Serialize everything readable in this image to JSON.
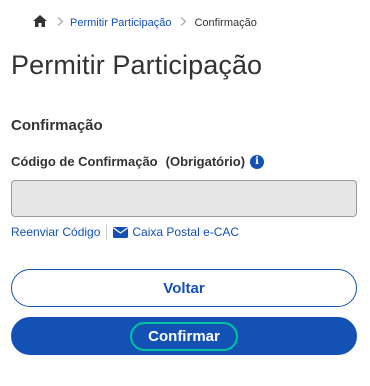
{
  "breadcrumb": {
    "home_icon": "home-icon",
    "items": [
      "Permitir Participação",
      "Confirmação"
    ]
  },
  "page": {
    "title": "Permitir Participação",
    "section": "Confirmação"
  },
  "form": {
    "label": "Código de Confirmação",
    "required": "(Obrigatório)",
    "info_icon": "info-icon",
    "code_value": "",
    "links": {
      "resend": "Reenviar Código",
      "mailbox": "Caixa Postal e-CAC",
      "mailbox_icon": "envelope-icon"
    }
  },
  "actions": {
    "back": "Voltar",
    "confirm": "Confirmar"
  },
  "colors": {
    "primary": "#1351b4",
    "input_bg": "#e6e6e6",
    "focus_ring": "#00c4a0"
  }
}
